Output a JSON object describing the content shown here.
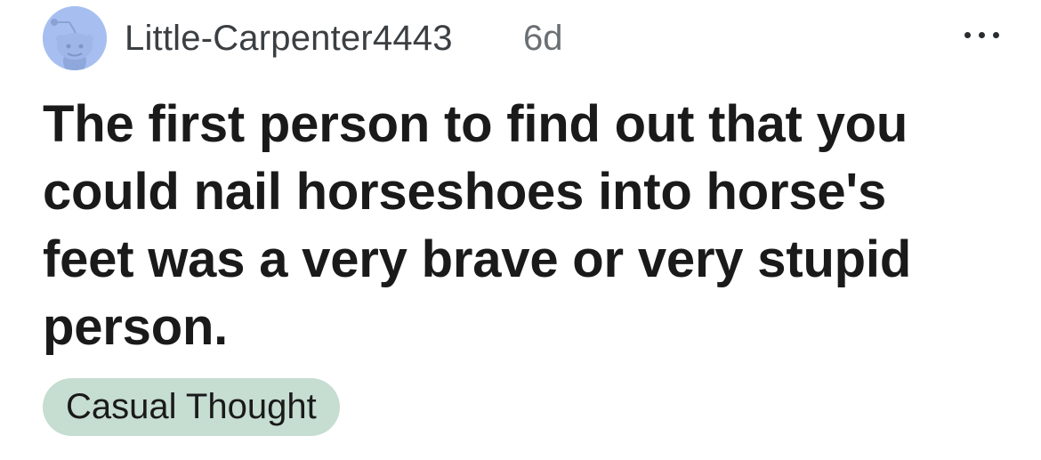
{
  "post": {
    "author": "Little-Carpenter4443",
    "age": "6d",
    "title_lines": [
      "The first person to find out that you",
      "could nail horseshoes into horse's",
      "feet was a very brave or very stupid",
      "person."
    ],
    "flair": "Casual Thought"
  },
  "icons": {
    "avatar": "reddit-snoo-avatar-icon",
    "more": "more-options-icon"
  },
  "colors": {
    "avatar_background": "#a7bff0",
    "flair_background": "#c6ddd1"
  }
}
